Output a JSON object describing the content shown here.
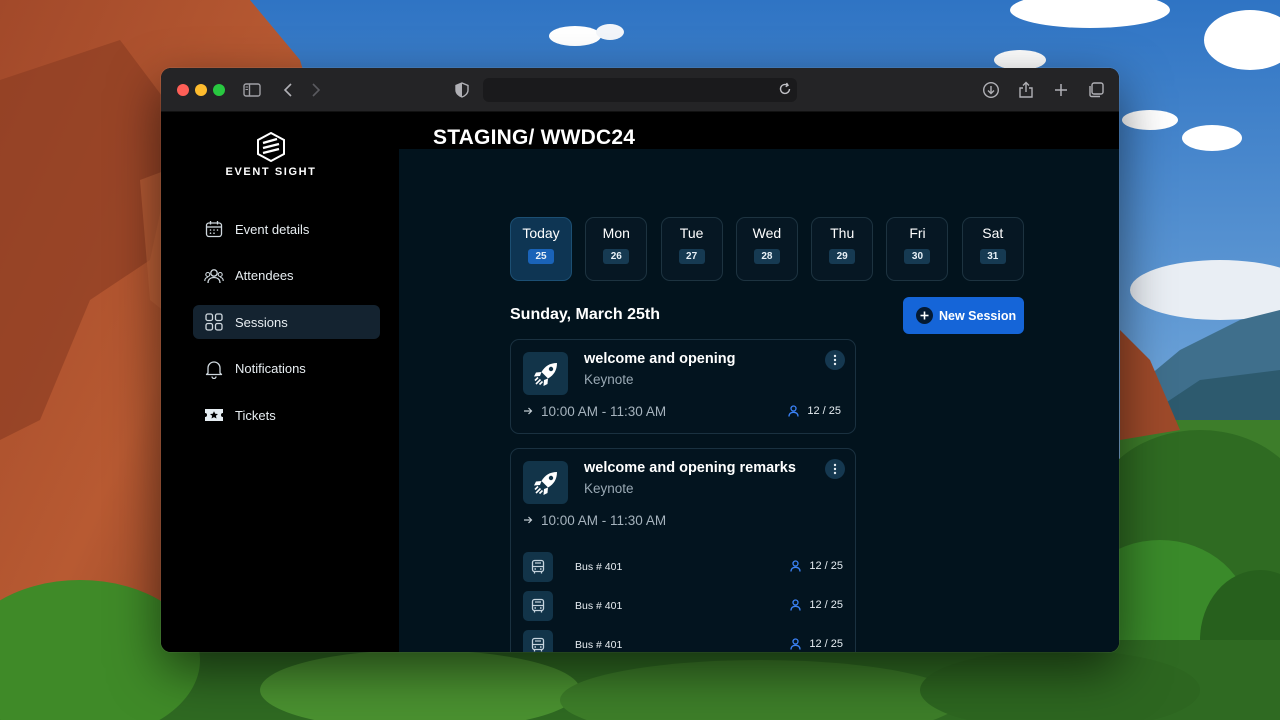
{
  "browser": {
    "url_value": "",
    "icons": [
      "sidebar-toggle-icon",
      "back-icon",
      "forward-icon",
      "shield-icon",
      "reload-icon",
      "download-icon",
      "share-icon",
      "new-tab-icon",
      "tabs-overview-icon"
    ]
  },
  "app": {
    "brand": "EVENT SIGHT",
    "page_title": "STAGING/ WWDC24"
  },
  "sidebar": {
    "items": [
      {
        "label": "Event details",
        "icon": "calendar-icon"
      },
      {
        "label": "Attendees",
        "icon": "users-icon"
      },
      {
        "label": "Sessions",
        "icon": "grid-icon",
        "active": true
      },
      {
        "label": "Notifications",
        "icon": "bell-icon"
      },
      {
        "label": "Tickets",
        "icon": "ticket-icon"
      }
    ]
  },
  "days": [
    {
      "name": "Today",
      "num": "25",
      "active": true
    },
    {
      "name": "Mon",
      "num": "26"
    },
    {
      "name": "Tue",
      "num": "27"
    },
    {
      "name": "Wed",
      "num": "28"
    },
    {
      "name": "Thu",
      "num": "29"
    },
    {
      "name": "Fri",
      "num": "30"
    },
    {
      "name": "Sat",
      "num": "31"
    }
  ],
  "date_heading": "Sunday, March 25th",
  "new_session_label": "New Session",
  "sessions": [
    {
      "title": "welcome and opening",
      "type": "Keynote",
      "time": "10:00 AM - 11:30 AM",
      "capacity": "12 / 25"
    },
    {
      "title": "welcome and opening remarks",
      "type": "Keynote",
      "time": "10:00 AM - 11:30 AM",
      "buses": [
        {
          "label": "Bus # 401",
          "capacity": "12 / 25"
        },
        {
          "label": "Bus # 401",
          "capacity": "12 / 25"
        },
        {
          "label": "Bus # 401",
          "capacity": "12 / 25"
        }
      ]
    }
  ],
  "colors": {
    "accent": "#1565d8",
    "active_day": "#0e3553",
    "main_bg": "#02131d"
  }
}
